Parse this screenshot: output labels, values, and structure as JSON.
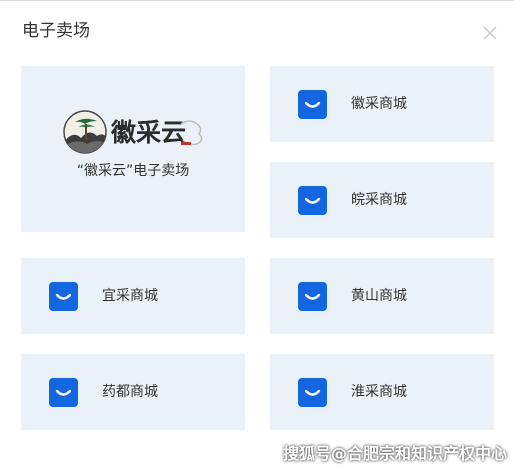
{
  "dialog": {
    "title": "电子卖场"
  },
  "featured": {
    "logo_text": "徽采云",
    "label": "“徽采云”电子卖场"
  },
  "stores": [
    {
      "label": "徽采商城"
    },
    {
      "label": "皖采商城"
    },
    {
      "label": "宜采商城"
    },
    {
      "label": "黄山商城"
    },
    {
      "label": "药都商城"
    },
    {
      "label": "淮采商城"
    }
  ],
  "watermark": "搜狐号@合肥宗和知识产权中心",
  "colors": {
    "card_bg": "#ebf1f8",
    "icon_blue": "#1266e0",
    "text": "#333333"
  },
  "icons": {
    "close": "close-icon",
    "store": "shopping-bag-icon",
    "logo": "landscape-pine-logo"
  }
}
